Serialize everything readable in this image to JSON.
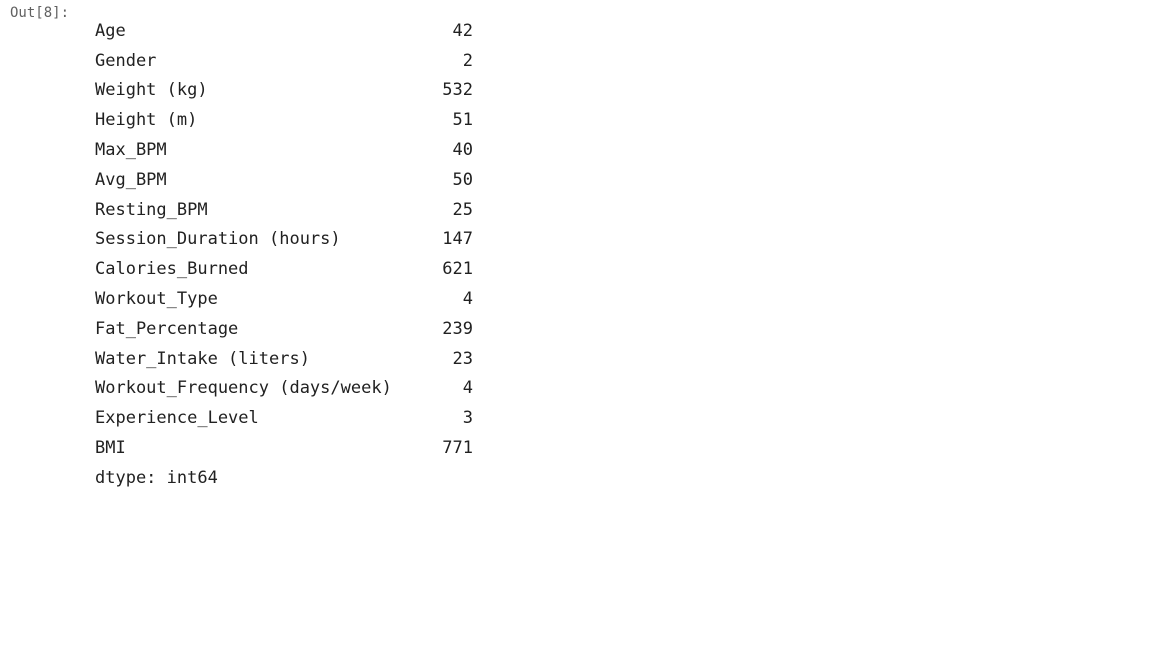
{
  "prompt": "Out[8]:",
  "rows": [
    {
      "label": "Age",
      "value": "42"
    },
    {
      "label": "Gender",
      "value": "2"
    },
    {
      "label": "Weight (kg)",
      "value": "532"
    },
    {
      "label": "Height (m)",
      "value": "51"
    },
    {
      "label": "Max_BPM",
      "value": "40"
    },
    {
      "label": "Avg_BPM",
      "value": "50"
    },
    {
      "label": "Resting_BPM",
      "value": "25"
    },
    {
      "label": "Session_Duration (hours)",
      "value": "147"
    },
    {
      "label": "Calories_Burned",
      "value": "621"
    },
    {
      "label": "Workout_Type",
      "value": "4"
    },
    {
      "label": "Fat_Percentage",
      "value": "239"
    },
    {
      "label": "Water_Intake (liters)",
      "value": "23"
    },
    {
      "label": "Workout_Frequency (days/week)",
      "value": "4"
    },
    {
      "label": "Experience_Level",
      "value": "3"
    },
    {
      "label": "BMI",
      "value": "771"
    }
  ],
  "dtype": "dtype: int64"
}
